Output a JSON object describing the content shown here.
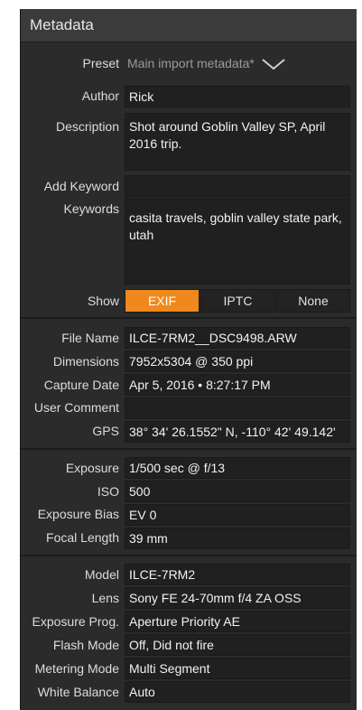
{
  "panel": {
    "title": "Metadata"
  },
  "preset": {
    "label": "Preset",
    "value": "Main import metadata*"
  },
  "author": {
    "label": "Author",
    "value": "Rick"
  },
  "description": {
    "label": "Description",
    "value": "Shot around Goblin Valley SP, April 2016 trip."
  },
  "add_keyword": {
    "label": "Add Keyword",
    "value": ""
  },
  "keywords": {
    "label": "Keywords",
    "value": "casita travels, goblin valley state park, utah"
  },
  "show": {
    "label": "Show",
    "options": [
      "EXIF",
      "IPTC",
      "None"
    ],
    "selected": "EXIF",
    "accent": "#f0891d"
  },
  "exif1": [
    {
      "label": "File Name",
      "value": "ILCE-7RM2__DSC9498.ARW"
    },
    {
      "label": "Dimensions",
      "value": "7952x5304 @ 350 ppi"
    },
    {
      "label": "Capture Date",
      "value": "Apr 5, 2016 • 8:27:17 PM"
    },
    {
      "label": "User Comment",
      "value": ""
    },
    {
      "label": "GPS",
      "value": "38° 34' 26.1552\" N, -110° 42' 49.142'"
    }
  ],
  "exif2": [
    {
      "label": "Exposure",
      "value": "1/500 sec @ f/13"
    },
    {
      "label": "ISO",
      "value": "500"
    },
    {
      "label": "Exposure Bias",
      "value": "EV 0"
    },
    {
      "label": "Focal Length",
      "value": "39 mm"
    }
  ],
  "exif3": [
    {
      "label": "Model",
      "value": "ILCE-7RM2"
    },
    {
      "label": "Lens",
      "value": "Sony FE 24-70mm f/4 ZA OSS"
    },
    {
      "label": "Exposure Prog.",
      "value": "Aperture Priority AE"
    },
    {
      "label": "Flash Mode",
      "value": "Off, Did not fire"
    },
    {
      "label": "Metering Mode",
      "value": "Multi Segment"
    },
    {
      "label": "White Balance",
      "value": "Auto"
    }
  ]
}
